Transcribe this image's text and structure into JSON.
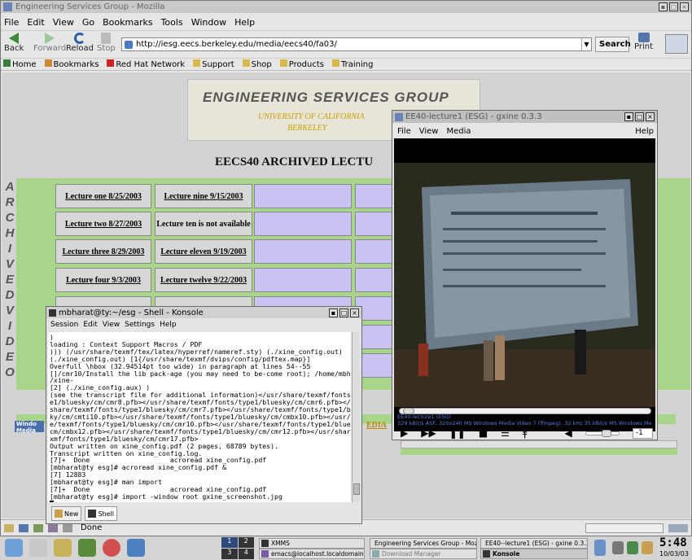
{
  "browser": {
    "title": "Engineering Services Group - Mozilla",
    "menu": [
      "File",
      "Edit",
      "View",
      "Go",
      "Bookmarks",
      "Tools",
      "Window",
      "Help"
    ],
    "back": "Back",
    "forward": "Forward",
    "reload": "Reload",
    "stop": "Stop",
    "url": "http://iesg.eecs.berkeley.edu/media/eecs40/fa03/",
    "search": "Search",
    "print": "Print",
    "bookmarks": [
      "Home",
      "Bookmarks",
      "Red Hat Network",
      "Support",
      "Shop",
      "Products",
      "Training"
    ],
    "status": "Done"
  },
  "page": {
    "banner_title": "ENGINEERING SERVICES GROUP",
    "banner_sub1": "UNIVERSITY OF CALIFORNIA",
    "banner_sub2": "BERKELEY",
    "heading": "EECS40 ARCHIVED LECTU",
    "side_letters": [
      "A",
      "R",
      "C",
      "H",
      "I",
      "V",
      "E",
      "D",
      "V",
      "I",
      "D",
      "E",
      "O"
    ],
    "lectures_col1": [
      "Lecture one 8/25/2003",
      "Lecture two 8/27/2003",
      "Lecture three 8/29/2003",
      "Lecture four 9/3/2003"
    ],
    "lectures_col2": [
      "Lecture nine 9/15/2003",
      "Lecture ten is not available",
      "Lecture eleven 9/19/2003",
      "Lecture twelve 9/22/2003"
    ],
    "media_label": "Windo Media",
    "media_link": "EDIA"
  },
  "player": {
    "title": "EE40-lecture1 (ESG) - gxine 0.3.3",
    "menu": [
      "File",
      "View",
      "Media"
    ],
    "help": "Help",
    "info1": "EE40-lecture1 (ESG)",
    "info2": "329 kBit/s ASF, 320x240 MS Windows Media Video 7 (ffmpeg), 32 kHz 35 kBit/s MS Windows Me",
    "time": "0:00:33 / 0:40:38",
    "progress_fraction": 0.014,
    "volume_fraction": 0.6,
    "spin_value": "-1"
  },
  "konsole": {
    "title": "mbharat@ty:~/esg - Shell - Konsole",
    "menu": [
      "Session",
      "Edit",
      "View",
      "Settings",
      "Help"
    ],
    "lines": [
      ")",
      "loading : Context Support Macros / PDF",
      "))) (/usr/share/texmf/tex/latex/hyperref/nameref.sty) (./xine_config.out)",
      "(./xine_config.out) [1{/usr/share/texmf/dvips/config/pdftex.map}]",
      "Overfull \\hbox (32.94514pt too wide) in paragraph at lines 54--55",
      "[]/cmr10/Install the lib pack-age (you may need to be-come root); /home/mbharat",
      "/xine-",
      "[2] (./xine_config.aux) )",
      "(see the transcript file for additional information)</usr/share/texmf/fonts/typ",
      "e1/bluesky/cm/cmr8.pfb></usr/share/texmf/fonts/type1/bluesky/cm/cmr6.pfb></usr/",
      "share/texmf/fonts/type1/bluesky/cm/cmr7.pfb></usr/share/texmf/fonts/type1/blues",
      "ky/cm/cmti10.pfb></usr/share/texmf/fonts/type1/bluesky/cm/cmbx10.pfb></usr/shar",
      "e/texmf/fonts/type1/bluesky/cm/cmr10.pfb></usr/share/texmf/fonts/type1/bluesky/",
      "cm/cmbx12.pfb></usr/share/texmf/fonts/type1/bluesky/cm/cmr12.pfb></usr/share/te",
      "xmf/fonts/type1/bluesky/cm/cmr17.pfb>",
      "Output written on xine_config.pdf (2 pages, 68789 bytes).",
      "Transcript written on xine_config.log.",
      "[7]+  Done                    acroread xine_config.pdf",
      "[mbharat@ty esg]# acroread xine_config.pdf &",
      "[7] 12883",
      "[mbharat@ty esg]# man import",
      "[7]+  Done                    acroread xine_config.pdf",
      "[mbharat@ty esg]# import -window root gxine_screenshot.jpg"
    ],
    "tab_new": "New",
    "tab_shell": "Shell"
  },
  "taskbar": {
    "desk": [
      "1",
      "2",
      "3",
      "4"
    ],
    "items": [
      "XMMS",
      "emacs@localhost.localdomain",
      "Engineering Services Group - Mozill",
      "Download Manager",
      "EE40--lecture1 (ESG) - gxine 0.3.3",
      "Konsole"
    ],
    "time": "5:48",
    "date": "10/03/03"
  }
}
